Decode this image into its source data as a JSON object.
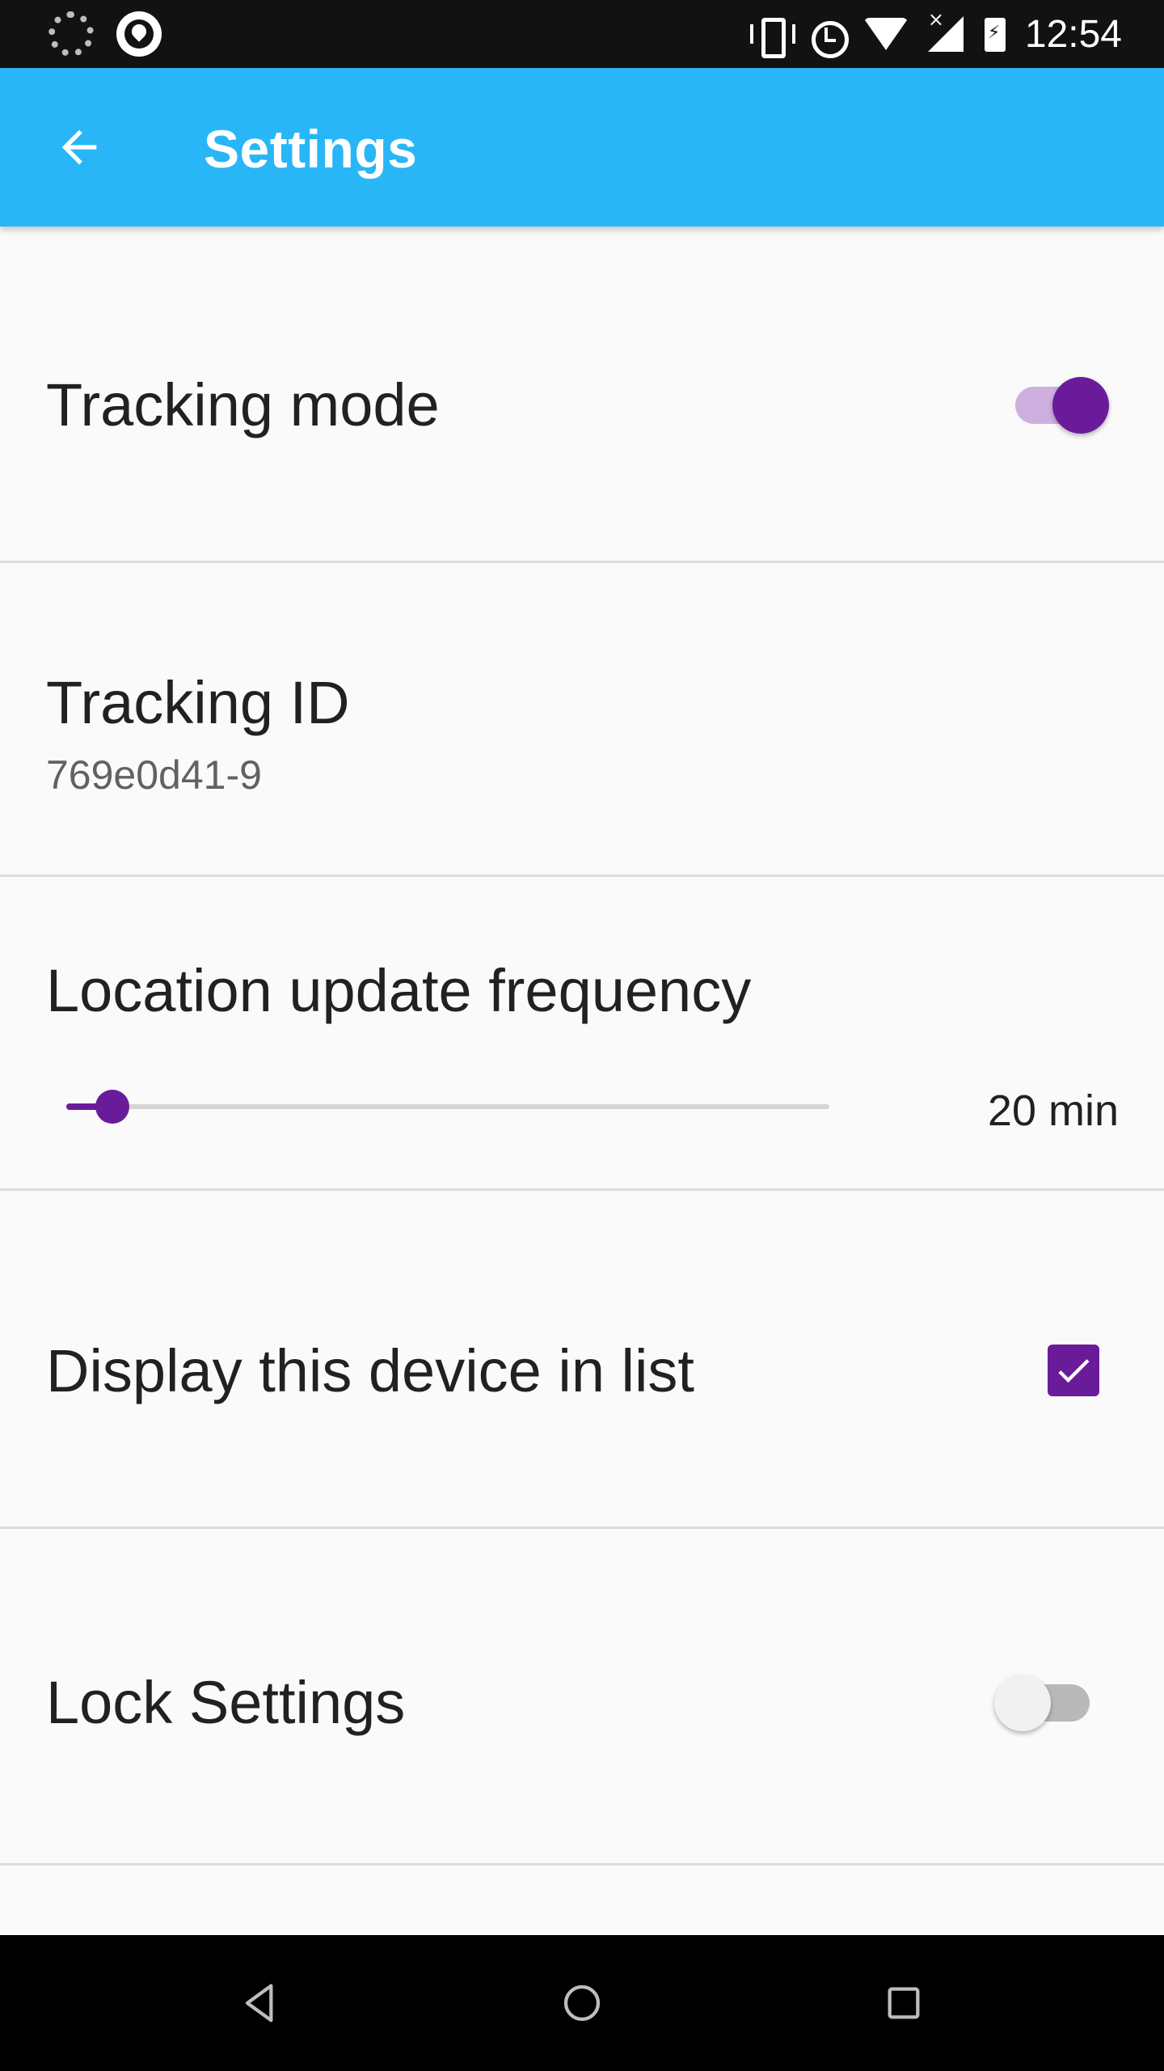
{
  "status_bar": {
    "time": "12:54",
    "left_icons": [
      "loading-icon",
      "location-pin-icon"
    ],
    "right_icons": [
      "vibrate-icon",
      "alarm-icon",
      "wifi-icon",
      "signal-icon",
      "battery-charging-icon"
    ]
  },
  "app_bar": {
    "title": "Settings",
    "back_icon": "arrow-back-icon",
    "background_color": "#29b6f6"
  },
  "preferences": [
    {
      "title": "Tracking mode",
      "control": "switch",
      "checked": true
    },
    {
      "title": "Tracking ID",
      "summary": "769e0d41-9"
    },
    {
      "title": "Location update frequency",
      "control": "slider",
      "value": 20,
      "value_label": "20 min"
    },
    {
      "title": "Display this device in list",
      "control": "checkbox",
      "checked": true
    },
    {
      "title": "Lock Settings",
      "control": "switch",
      "checked": false
    }
  ],
  "accent_color": "#6a1b9a",
  "nav_bar": {
    "buttons": [
      "nav-back-icon",
      "nav-home-icon",
      "nav-recents-icon"
    ]
  }
}
